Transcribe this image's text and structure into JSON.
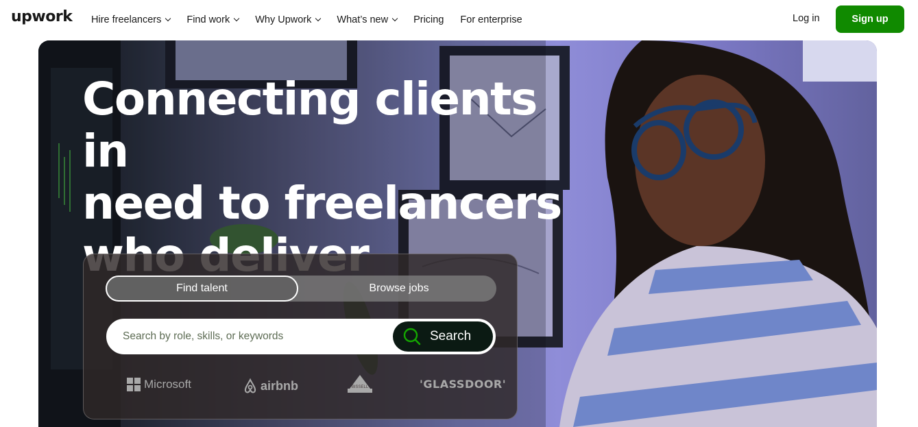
{
  "nav": {
    "logo": "upwork",
    "links": [
      {
        "label": "Hire freelancers",
        "has_dropdown": true
      },
      {
        "label": "Find work",
        "has_dropdown": true
      },
      {
        "label": "Why Upwork",
        "has_dropdown": true
      },
      {
        "label": "What’s new",
        "has_dropdown": true
      },
      {
        "label": "Pricing",
        "has_dropdown": false
      },
      {
        "label": "For enterprise",
        "has_dropdown": false
      }
    ],
    "login_label": "Log in",
    "signup_label": "Sign up"
  },
  "hero": {
    "headline_lines": [
      "Connecting clients in",
      "need to freelancers",
      "who deliver"
    ],
    "tabs": {
      "talent": "Find talent",
      "jobs": "Browse jobs",
      "selected": "talent"
    },
    "search": {
      "placeholder": "Search by role, skills, or keywords",
      "value": "",
      "button_label": "Search"
    },
    "logos": {
      "microsoft": "Microsoft",
      "airbnb": "airbnb",
      "bissell": "BISSELL",
      "glassdoor": "'GLASSDOOR'"
    }
  },
  "colors": {
    "brand_green": "#108a00",
    "search_button": "#0b1a13",
    "search_icon": "#14a800"
  },
  "icons": [
    "chevron-down-icon",
    "search-icon",
    "microsoft-logo-icon",
    "airbnb-logo-icon",
    "bissell-logo-icon"
  ]
}
